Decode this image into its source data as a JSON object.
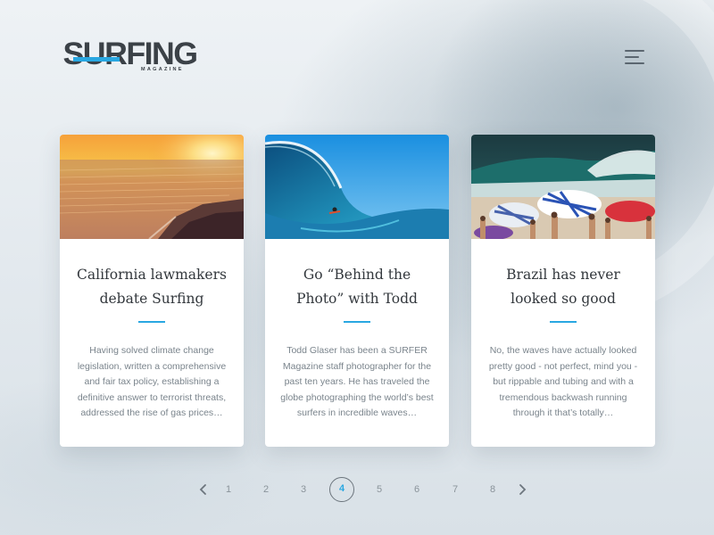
{
  "header": {
    "logo_word": "SURFING",
    "logo_sub": "MAGAZINE",
    "menu_icon": "hamburger-menu-icon"
  },
  "cards": [
    {
      "title_line1": "California lawmakers",
      "title_line2": "debate Surfing",
      "excerpt": "Having solved climate change legislation, written a comprehensive and fair tax policy, establishing a definitive answer to terrorist threats, addressed the rise of gas prices…",
      "image": "sunset-coastline-photo"
    },
    {
      "title_line1": "Go “Behind the",
      "title_line2": "Photo” with Todd",
      "excerpt": "Todd Glaser has been a SURFER Magazine staff photographer for the past ten years. He has traveled the globe photographing the world’s best surfers in incredible waves…",
      "image": "barrel-wave-surfer-photo"
    },
    {
      "title_line1": "Brazil has never",
      "title_line2": "looked so good",
      "excerpt": "No, the waves have actually looked pretty good - not perfect, mind you - but rippable and tubing and with a tremendous backwash running through it that’s totally…",
      "image": "brazil-beach-umbrellas-photo"
    }
  ],
  "pagination": {
    "pages": [
      "1",
      "2",
      "3",
      "4",
      "5",
      "6",
      "7",
      "8"
    ],
    "current": "4",
    "prev_icon": "chevron-left-icon",
    "next_icon": "chevron-right-icon"
  },
  "colors": {
    "accent": "#29a7e1",
    "text_dark": "#33383d",
    "text_muted": "#7a848c"
  }
}
